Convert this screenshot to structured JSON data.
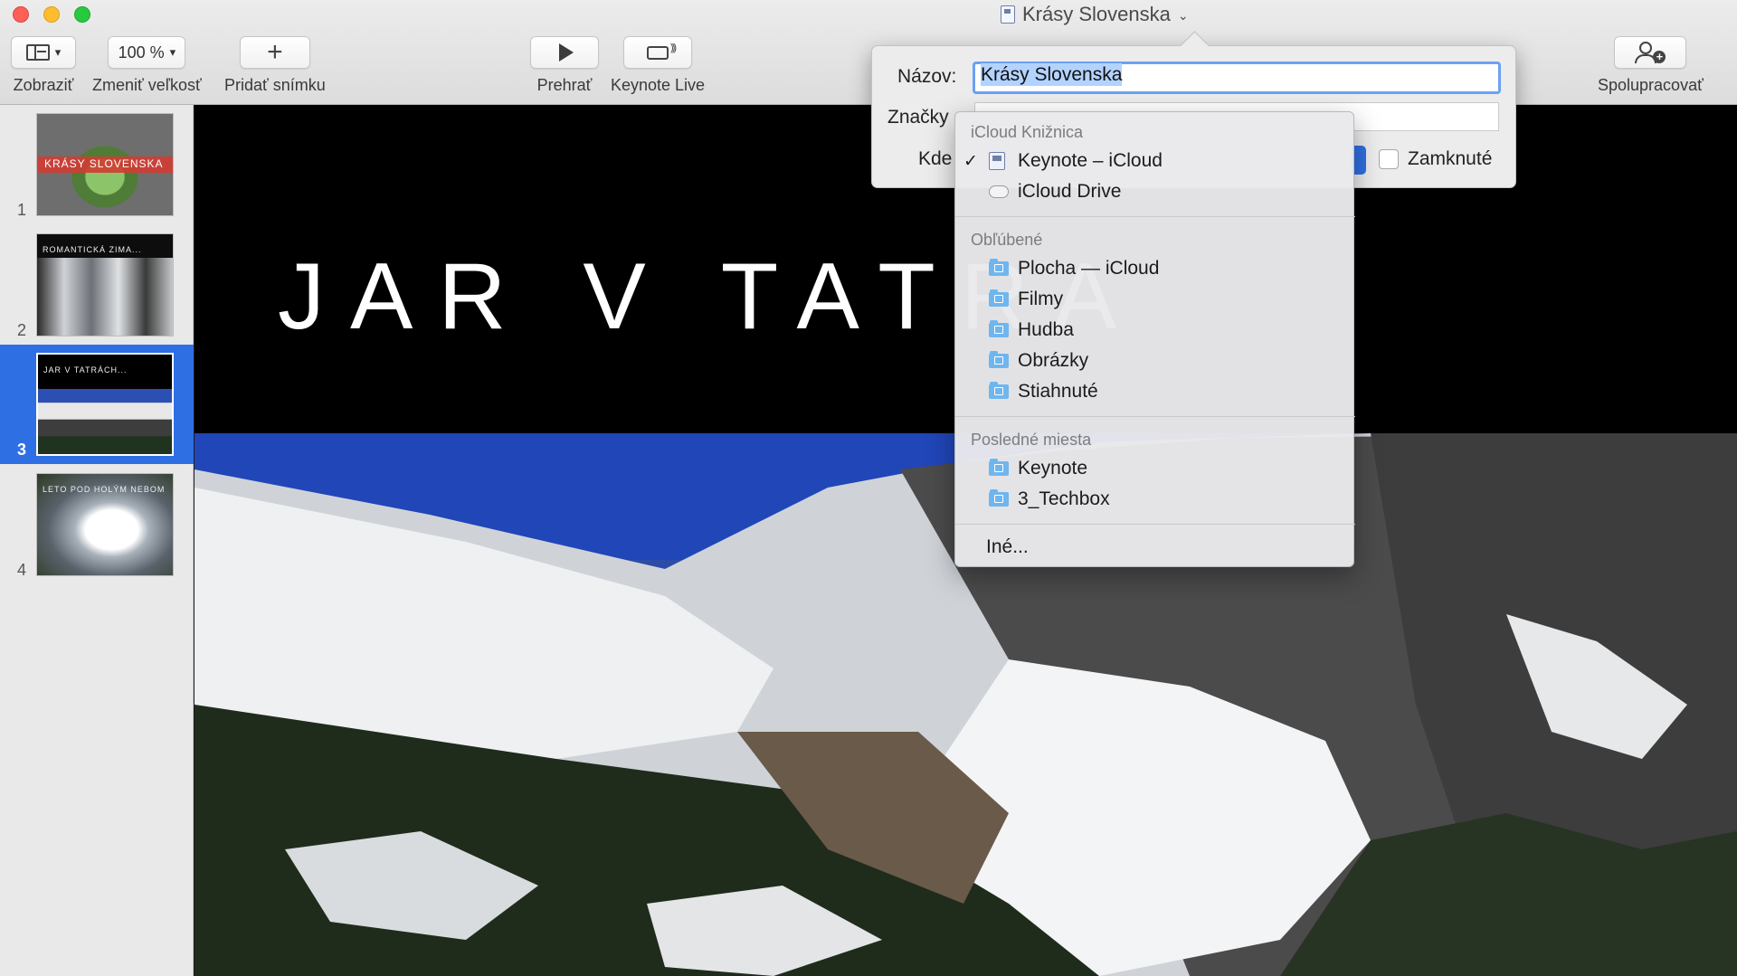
{
  "window": {
    "title": "Krásy Slovenska"
  },
  "toolbar": {
    "view_label": "Zobraziť",
    "zoom_value": "100 %",
    "zoom_label": "Zmeniť veľkosť",
    "add_slide_label": "Pridať snímku",
    "play_label": "Prehrať",
    "keynote_live_label": "Keynote Live",
    "collaborate_label": "Spolupracovať"
  },
  "sidebar": {
    "slides": [
      {
        "number": "1",
        "caption": "KRÁSY SLOVENSKA",
        "selected": false
      },
      {
        "number": "2",
        "caption": "ROMANTICKÁ ZIMA...",
        "selected": false
      },
      {
        "number": "3",
        "caption": "JAR V TATRÁCH...",
        "selected": true
      },
      {
        "number": "4",
        "caption": "LETO POD HOLÝM NEBOM",
        "selected": false
      }
    ]
  },
  "slide": {
    "title": "JAR V TATRA"
  },
  "save_dialog": {
    "name_label": "Názov:",
    "name_value": "Krásy Slovenska",
    "tags_label": "Značky",
    "where_label": "Kde",
    "locked_label": "Zamknuté",
    "locked_checked": false
  },
  "location_menu": {
    "sections": [
      {
        "header": "iCloud Knižnica",
        "items": [
          {
            "label": "Keynote – iCloud",
            "icon": "keynote-app-icon",
            "checked": true
          },
          {
            "label": "iCloud Drive",
            "icon": "cloud-icon",
            "checked": false
          }
        ]
      },
      {
        "header": "Obľúbené",
        "items": [
          {
            "label": "Plocha — iCloud",
            "icon": "folder-icon",
            "checked": false
          },
          {
            "label": "Filmy",
            "icon": "movies-folder-icon",
            "checked": false
          },
          {
            "label": "Hudba",
            "icon": "music-folder-icon",
            "checked": false
          },
          {
            "label": "Obrázky",
            "icon": "pictures-folder-icon",
            "checked": false
          },
          {
            "label": "Stiahnuté",
            "icon": "downloads-folder-icon",
            "checked": false
          }
        ]
      },
      {
        "header": "Posledné miesta",
        "items": [
          {
            "label": "Keynote",
            "icon": "folder-icon",
            "checked": false
          },
          {
            "label": "3_Techbox",
            "icon": "folder-icon",
            "checked": false
          }
        ]
      }
    ],
    "other_label": "Iné...",
    "check_glyph": "✓"
  },
  "colors": {
    "selection_blue": "#2f6fe4",
    "focus_ring": "#6aa1f4",
    "folder_blue": "#6fb6ee"
  }
}
